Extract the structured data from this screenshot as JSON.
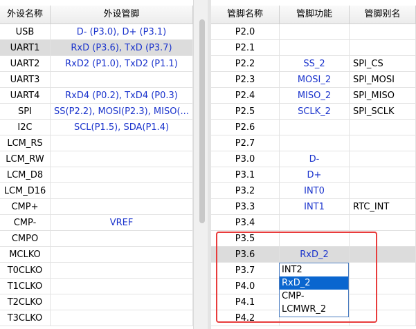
{
  "peripheral_table": {
    "headers": [
      "外设名称",
      "外设管脚"
    ],
    "rows": [
      {
        "name": "USB",
        "pins": "D- (P3.0), D+ (P3.1)"
      },
      {
        "name": "UART1",
        "pins": "RxD (P3.6), TxD (P3.7)",
        "selected": true
      },
      {
        "name": "UART2",
        "pins": "RxD2 (P1.0), TxD2 (P1.1)"
      },
      {
        "name": "UART3",
        "pins": ""
      },
      {
        "name": "UART4",
        "pins": "RxD4 (P0.2), TxD4 (P0.3)"
      },
      {
        "name": "SPI",
        "pins": "SS(P2.2), MOSI(P2.3), MISO(..."
      },
      {
        "name": "I2C",
        "pins": "SCL(P1.5), SDA(P1.4)"
      },
      {
        "name": "LCM_RS",
        "pins": ""
      },
      {
        "name": "LCM_RW",
        "pins": ""
      },
      {
        "name": "LCM_D8",
        "pins": ""
      },
      {
        "name": "LCM_D16",
        "pins": ""
      },
      {
        "name": "CMP+",
        "pins": ""
      },
      {
        "name": "CMP-",
        "pins": "VREF"
      },
      {
        "name": "CMPO",
        "pins": ""
      },
      {
        "name": "MCLKO",
        "pins": ""
      },
      {
        "name": "T0CLKO",
        "pins": ""
      },
      {
        "name": "T1CLKO",
        "pins": ""
      },
      {
        "name": "T2CLKO",
        "pins": ""
      },
      {
        "name": "T3CLKO",
        "pins": ""
      }
    ]
  },
  "pin_table": {
    "headers": [
      "管脚名称",
      "管脚功能",
      "管脚别名"
    ],
    "rows": [
      {
        "pin": "P2.0",
        "function": "",
        "alias": ""
      },
      {
        "pin": "P2.1",
        "function": "",
        "alias": ""
      },
      {
        "pin": "P2.2",
        "function": "SS_2",
        "alias": "SPI_CS"
      },
      {
        "pin": "P2.3",
        "function": "MOSI_2",
        "alias": "SPI_MOSI"
      },
      {
        "pin": "P2.4",
        "function": "MISO_2",
        "alias": "SPI_MISO"
      },
      {
        "pin": "P2.5",
        "function": "SCLK_2",
        "alias": "SPI_SCLK"
      },
      {
        "pin": "P2.6",
        "function": "",
        "alias": ""
      },
      {
        "pin": "P2.7",
        "function": "",
        "alias": ""
      },
      {
        "pin": "P3.0",
        "function": "D-",
        "alias": ""
      },
      {
        "pin": "P3.1",
        "function": "D+",
        "alias": ""
      },
      {
        "pin": "P3.2",
        "function": "INT0",
        "alias": ""
      },
      {
        "pin": "P3.3",
        "function": "INT1",
        "alias": "RTC_INT"
      },
      {
        "pin": "P3.4",
        "function": "",
        "alias": ""
      },
      {
        "pin": "P3.5",
        "function": "",
        "alias": ""
      },
      {
        "pin": "P3.6",
        "function": "RxD_2",
        "alias": "",
        "selected": true
      },
      {
        "pin": "P3.7",
        "function": "",
        "alias": ""
      },
      {
        "pin": "P4.0",
        "function": "",
        "alias": ""
      },
      {
        "pin": "P4.1",
        "function": "",
        "alias": ""
      },
      {
        "pin": "P4.2",
        "function": "",
        "alias": ""
      }
    ]
  },
  "function_dropdown": {
    "options": [
      "INT2",
      "RxD_2",
      "CMP-",
      "LCMWR_2"
    ],
    "selected": "RxD_2"
  },
  "colors": {
    "value_text": "#1a33cc",
    "selected_row": "#dcdcdc",
    "dropdown_highlight": "#0a66cf",
    "annotation_box": "#e83c3c"
  }
}
